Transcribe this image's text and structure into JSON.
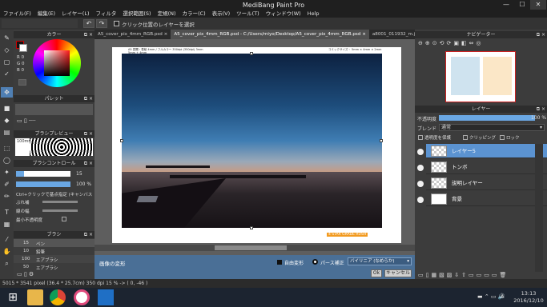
{
  "window": {
    "title": "MediBang Paint Pro",
    "minimize": "—",
    "maximize": "☐",
    "close": "✕"
  },
  "menu": [
    "ファイル(F)",
    "編集(E)",
    "レイヤー(L)",
    "フィルタ",
    "選択範囲(S)",
    "定規(N)",
    "カラー(C)",
    "表示(V)",
    "ツール(T)",
    "ウィンドウ(W)",
    "Help"
  ],
  "toolbar": {
    "undo": "↶",
    "redo": "↷",
    "checkbox_label": "クリック位置のレイヤーを選択"
  },
  "tabs": [
    {
      "label": "A5_cover_pix_4mm_RGB.psd",
      "close": "×"
    },
    {
      "label": "A5_cover_pix_4mm_RGB.psd - C:/Users/miyo/Desktop/A5_cover_pix_4mm_RGB.psd",
      "close": "×"
    },
    {
      "label": "a8001_011932_m.jpg - C:/Users/miyo/Desktop",
      "close": "×"
    }
  ],
  "panels": {
    "color": "カラー",
    "palette": "パレット",
    "brush_preview": "ブラシプレビュー",
    "brush_control": "ブラシコントロール",
    "brush": "ブラシ",
    "navigator": "ナビゲーター",
    "layer": "レイヤー"
  },
  "color_panel": {
    "r": "R 0",
    "g": "G 0",
    "b": "B 0",
    "accent": "#cc0000"
  },
  "brush_preview": {
    "size": "100mm"
  },
  "brush_control": {
    "size": "15",
    "opacity": "100 %",
    "hint": "Ctrl+クリックで基点指定 (キャンバス",
    "blur": "ぶれ補",
    "min_width": "線の幅",
    "min_opacity": "最小不透明度"
  },
  "brushes": [
    {
      "size": "15",
      "name": "ペン"
    },
    {
      "size": "10",
      "name": "鉛筆"
    },
    {
      "size": "100",
      "name": "エアブラシ"
    },
    {
      "size": "50",
      "name": "エアブラシ"
    }
  ],
  "document": {
    "header_left": "A5 見開・表紙 4mm / フルカラー 350dpi (350dpi) 3mm",
    "header_sub": "5mm + 4mm",
    "header_right": "コミックサイズ・ 5mm × 4mm × 2mm",
    "footer": "4 STAR GRADE RUSH"
  },
  "transform_bar": {
    "label": "画像の変形",
    "free": "自由変形",
    "perspective": "パース補正",
    "interp": "バイリニア (なめらか)",
    "ok": "Ok",
    "cancel": "キャンセル"
  },
  "layer_panel": {
    "opacity_label": "不透明度",
    "opacity_value": "100 %",
    "blend_label": "ブレンド",
    "blend_value": "通常",
    "protect": "透明度を保護",
    "clipping": "クリッピング",
    "lock": "ロック",
    "layers": [
      {
        "name": "レイヤー5",
        "selected": true
      },
      {
        "name": "トンボ",
        "selected": false
      },
      {
        "name": "説明レイヤー",
        "selected": false
      },
      {
        "name": "背景",
        "selected": false
      }
    ]
  },
  "status": "5015 * 3541 pixel  (36.4 * 25.7cm)  350 dpi  15 %  -> ( 0, -46 )",
  "taskbar": {
    "time": "13:13",
    "date": "2016/12/10",
    "lang": "A"
  }
}
